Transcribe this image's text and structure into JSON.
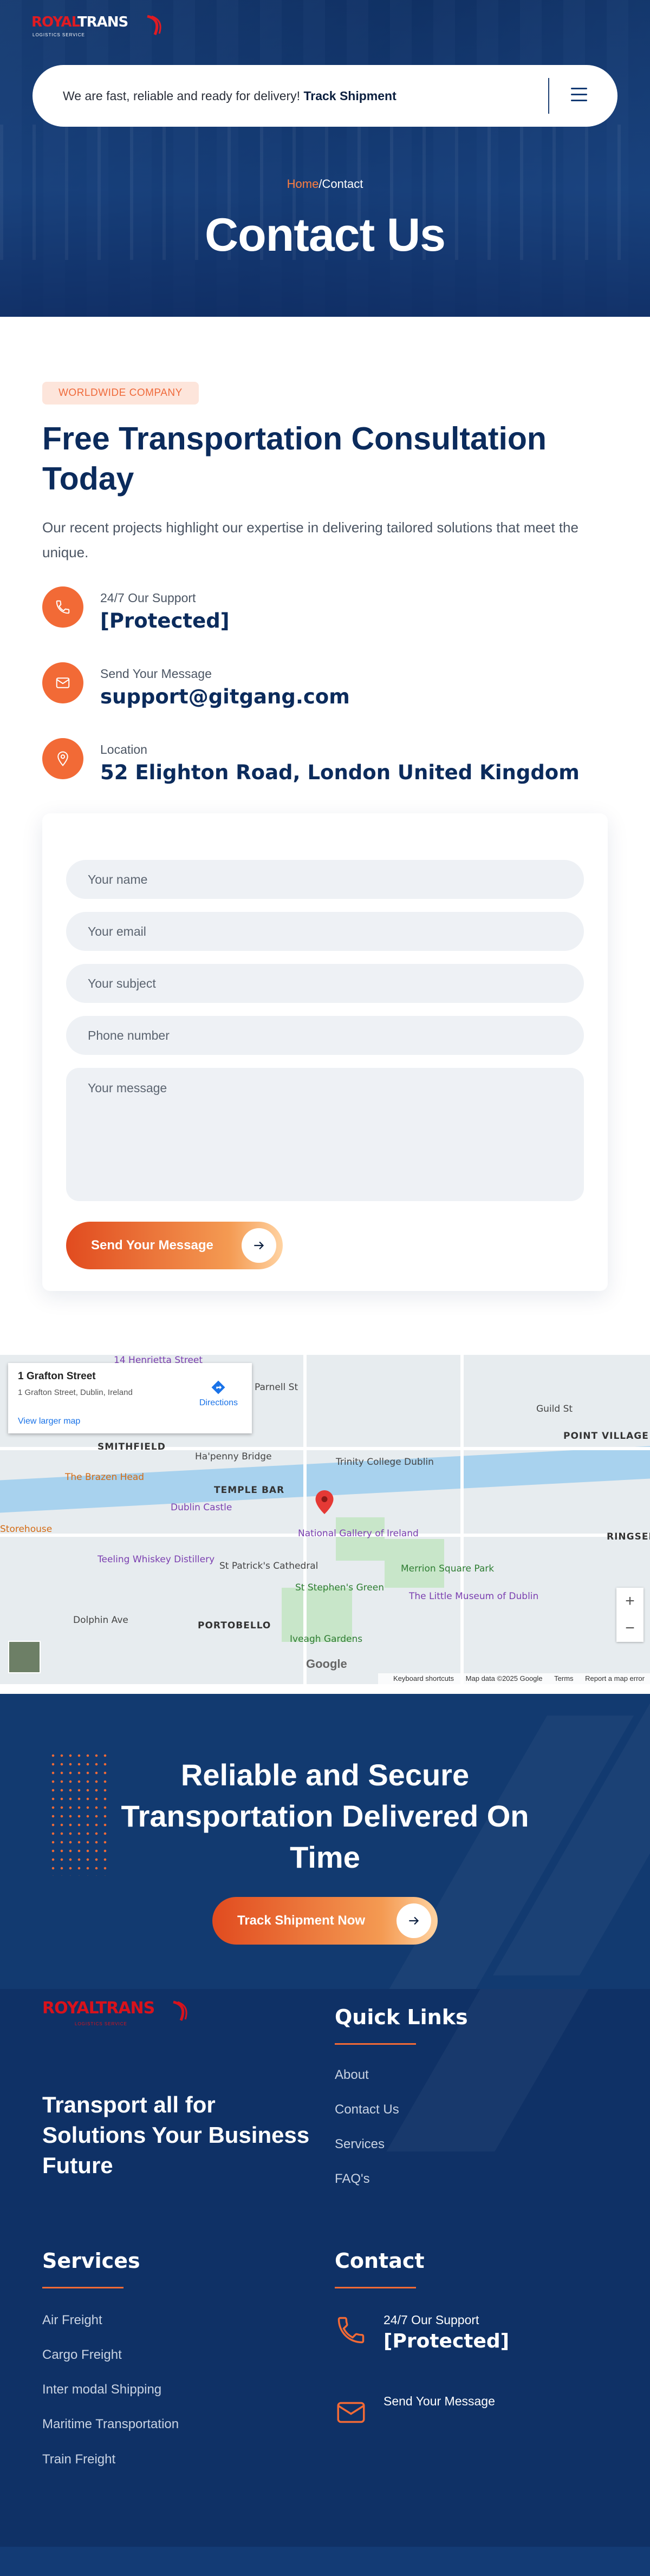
{
  "brand": {
    "logo_part1": "ROYAL",
    "logo_part2": "TRANS",
    "logo_tagline": "LOGISTICS SERVICE",
    "accent_color": "#f26a36",
    "navy_color": "#0b2b5c"
  },
  "header": {
    "message": "We are fast, reliable and ready for delivery!",
    "message_link": "Track Shipment",
    "menu_icon": "hamburger-menu-icon"
  },
  "breadcrumb": {
    "home": "Home",
    "separator": "/",
    "current": "Contact"
  },
  "hero": {
    "title": "Contact Us"
  },
  "contact": {
    "badge": "WORLDWIDE COMPANY",
    "heading": "Free Transportation Consultation Today",
    "lead": "Our recent projects highlight our expertise in delivering tailored solutions that meet the unique.",
    "items": [
      {
        "icon": "phone-icon",
        "label": "24/7 Our Support",
        "value": "[Protected]"
      },
      {
        "icon": "mail-icon",
        "label": "Send Your Message",
        "value": "support@gitgang.com"
      },
      {
        "icon": "location-pin-icon",
        "label": "Location",
        "value": "52 Elighton Road, London United Kingdom"
      }
    ]
  },
  "form": {
    "name_placeholder": "Your name",
    "email_placeholder": "Your email",
    "subject_placeholder": "Your subject",
    "phone_placeholder": "Phone number",
    "message_placeholder": "Your message",
    "submit_label": "Send Your Message"
  },
  "map": {
    "place_title": "1 Grafton Street",
    "place_address": "1 Grafton Street, Dublin, Ireland",
    "directions_label": "Directions",
    "larger_map_label": "View larger map",
    "labels": {
      "henrietta": "14 Henrietta Street",
      "smithfield": "SMITHFIELD",
      "hapenny": "Ha'penny Bridge",
      "trinity": "Trinity College Dublin",
      "point": "POINT VILLAGE",
      "brazen": "The Brazen Head",
      "temple": "TEMPLE BAR",
      "castle": "Dublin Castle",
      "ringsend": "RINGSEN",
      "gallery": "National Gallery of Ireland",
      "storehouse": "Storehouse",
      "teeling": "Teeling Whiskey Distillery",
      "patrick": "St Patrick's Cathedral",
      "merrion": "Merrion Square Park",
      "stephens": "St Stephen's Green",
      "museum": "The Little Museum of Dublin",
      "portobello": "PORTOBELLO",
      "iveagh": "Iveagh Gardens",
      "dolphin": "Dolphin Ave",
      "parnell": "Parnell St",
      "guild": "Guild St"
    },
    "zoom_in": "+",
    "zoom_out": "−",
    "google": "Google",
    "footer_shortcuts": "Keyboard shortcuts",
    "footer_data": "Map data ©2025 Google",
    "footer_terms": "Terms",
    "footer_report": "Report a map error"
  },
  "cta": {
    "title": "Reliable and Secure Transportation Delivered On Time",
    "button": "Track Shipment Now"
  },
  "footer": {
    "tagline": "Transport all for Solutions Your Business Future",
    "quick_links_title": "Quick Links",
    "quick_links": [
      "About",
      "Contact Us",
      "Services",
      "FAQ's"
    ],
    "services_title": "Services",
    "services": [
      "Air Freight",
      "Cargo Freight",
      "Inter modal Shipping",
      "Maritime Transportation",
      "Train Freight"
    ],
    "contact_title": "Contact",
    "contact_support_label": "24/7 Our Support",
    "contact_support_value": "[Protected]",
    "contact_message_label": "Send Your Message"
  }
}
